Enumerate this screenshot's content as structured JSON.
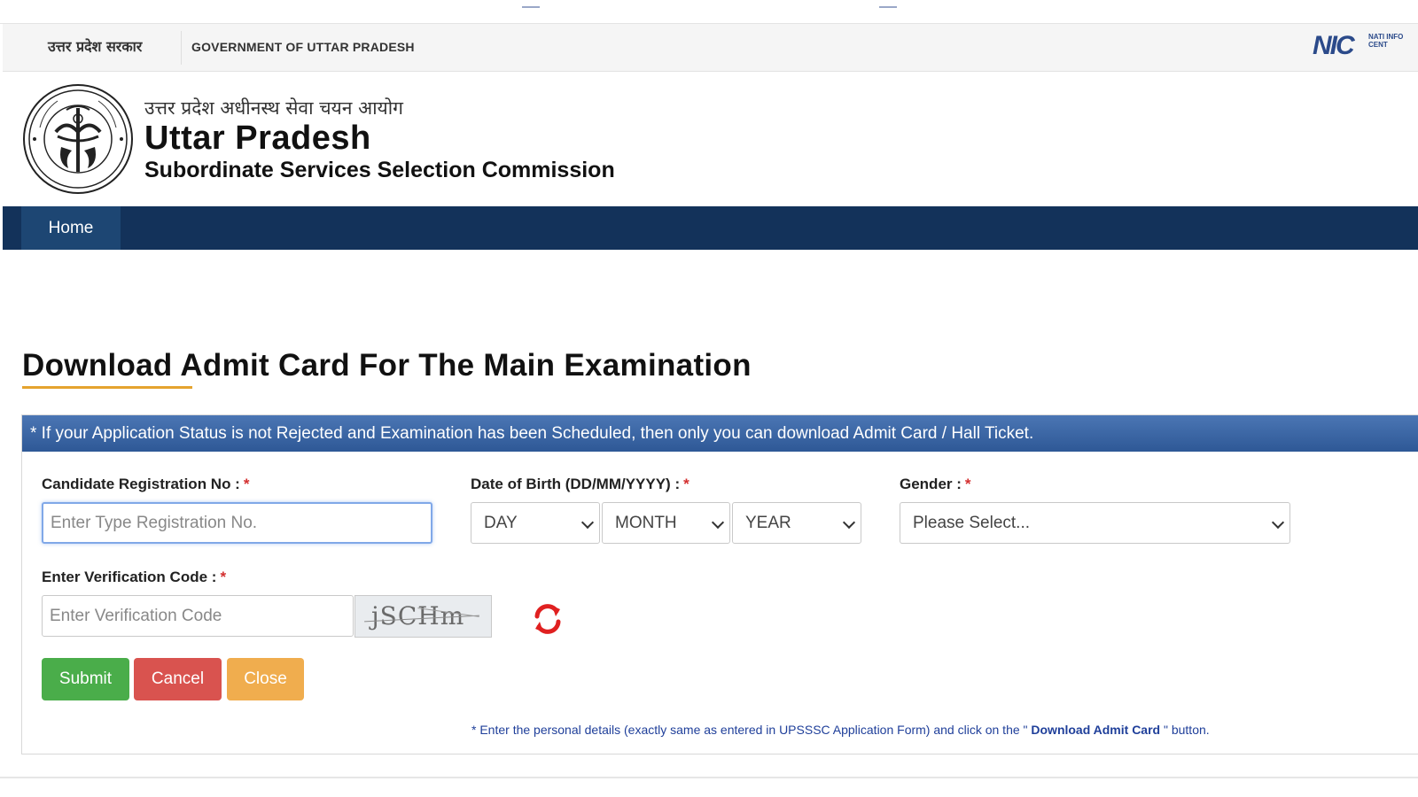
{
  "gov_bar": {
    "hindi": "उत्तर प्रदेश सरकार",
    "english": "GOVERNMENT OF UTTAR PRADESH",
    "nic_logo": "NIC",
    "nic_sub": "NATI INFO CENT"
  },
  "header": {
    "hindi_title": "उत्तर प्रदेश अधीनस्थ सेवा चयन आयोग",
    "title": "Uttar Pradesh",
    "subtitle": "Subordinate Services Selection Commission",
    "emblem_icon": "up-state-emblem-icon"
  },
  "nav": {
    "home": "Home"
  },
  "page": {
    "title": "Download Admit Card For The Main Examination"
  },
  "panel": {
    "notice": "* If your Application Status is not Rejected and Examination has been Scheduled, then only you can download Admit Card / Hall Ticket.",
    "reg_label": "Candidate Registration No :",
    "reg_placeholder": "Enter Type Registration No.",
    "dob_label": "Date of Birth (DD/MM/YYYY) :",
    "day": "DAY",
    "month": "MONTH",
    "year": "YEAR",
    "gender_label": "Gender :",
    "gender_value": "Please Select...",
    "code_label": "Enter Verification Code :",
    "code_placeholder": "Enter Verification Code",
    "captcha_text": "jSCHm",
    "required_mark": "*",
    "submit": "Submit",
    "cancel": "Cancel",
    "close": "Close",
    "note_pre": "* Enter the personal details (exactly same as entered in UPSSSC Application Form) and click on the \"",
    "note_bold": " Download Admit Card ",
    "note_post": "\" button."
  },
  "colors": {
    "navbar": "#13325a",
    "panel_header": "#2e5896",
    "submit": "#4aad4a",
    "cancel": "#d9534f",
    "close": "#f0ad4e",
    "accent_underline": "#e5a32e",
    "refresh_icon": "#e02020"
  }
}
